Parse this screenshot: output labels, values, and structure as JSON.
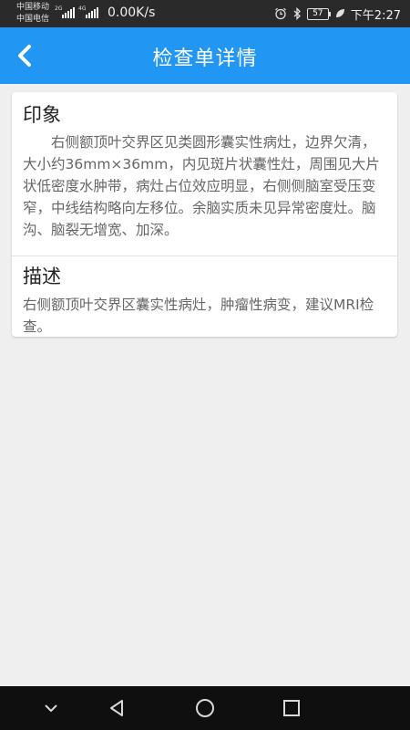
{
  "status_bar": {
    "carrier_1": "中国移动",
    "carrier_2": "中国电信",
    "network_1": "2G",
    "network_2": "4G",
    "speed": "0.00K/s",
    "battery": "57",
    "time": "下午2:27",
    "icons": [
      "alarm-icon",
      "bluetooth-icon",
      "battery-icon",
      "leaf-icon"
    ]
  },
  "header": {
    "title": "检查单详情",
    "back_icon": "chevron-left-icon"
  },
  "report": {
    "impression_heading": "印象",
    "impression_text": "　　右侧额顶叶交界区见类圆形囊实性病灶，边界欠清，大小约36mm×36mm，内见斑片状囊性灶，周围见大片状低密度水肿带，病灶占位效应明显，右侧侧脑室受压变窄，中线结构略向左移位。余脑实质未见异常密度灶。脑沟、脑裂无增宽、加深。",
    "description_heading": "描述",
    "description_text": "右侧额顶叶交界区囊实性病灶，肿瘤性病变，建议MRI检查。"
  },
  "nav_bar": {
    "icons": [
      "chevron-down-icon",
      "back-triangle-icon",
      "home-circle-icon",
      "recents-square-icon"
    ]
  },
  "colors": {
    "app_bar": "#2196f3",
    "background": "#efefef",
    "status_bar": "#2a2a2a",
    "nav_bar": "#0f0f0f"
  }
}
